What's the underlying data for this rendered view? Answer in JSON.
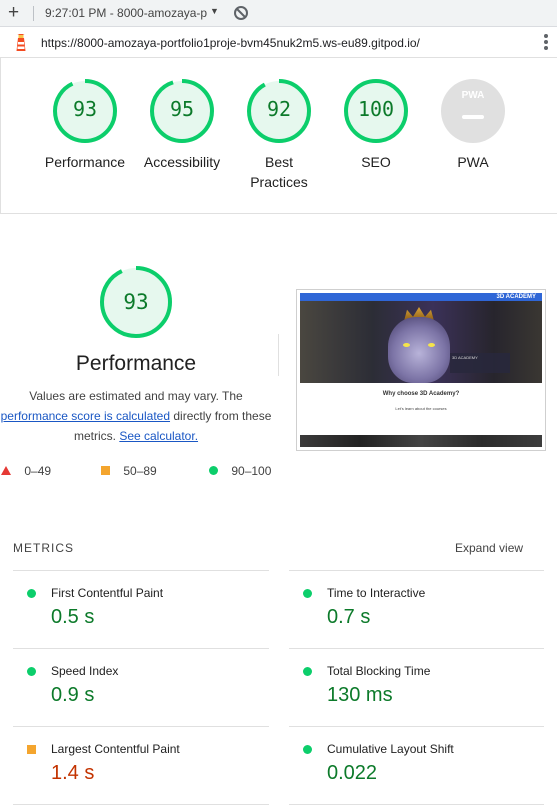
{
  "browser": {
    "tab_title": "9:27:01 PM - 8000-amozaya-p",
    "url": "https://8000-amozaya-portfolio1proje-bvm45nuk2m5.ws-eu89.gitpod.io/"
  },
  "gauges": [
    {
      "score": "93",
      "label": "Performance",
      "status": "pass"
    },
    {
      "score": "95",
      "label": "Accessibility",
      "status": "pass"
    },
    {
      "score": "92",
      "label": "Best Practices",
      "status": "pass"
    },
    {
      "score": "100",
      "label": "SEO",
      "status": "pass"
    },
    {
      "score": "",
      "label": "PWA",
      "status": "na",
      "badge": "PWA"
    }
  ],
  "performance": {
    "score": "93",
    "title": "Performance",
    "desc_part1": "Values are estimated and may vary. The",
    "desc_link": "performance score is calculated",
    "desc_part2": "directly from these",
    "desc_part3": "metrics.",
    "calc_link": "See calculator."
  },
  "legend": {
    "fail": "0–49",
    "average": "50–89",
    "pass": "90–100"
  },
  "thumbnail": {
    "brand": "3D ACADEMY",
    "hero_caption": "3D ACADEMY",
    "heading": "Why choose 3D Academy?",
    "subtext": "Let's learn about the courses"
  },
  "metrics": {
    "heading": "METRICS",
    "expand": "Expand view",
    "items": [
      {
        "name": "First Contentful Paint",
        "value": "0.5 s",
        "status": "pass"
      },
      {
        "name": "Time to Interactive",
        "value": "0.7 s",
        "status": "pass"
      },
      {
        "name": "Speed Index",
        "value": "0.9 s",
        "status": "pass"
      },
      {
        "name": "Total Blocking Time",
        "value": "130 ms",
        "status": "pass"
      },
      {
        "name": "Largest Contentful Paint",
        "value": "1.4 s",
        "status": "average"
      },
      {
        "name": "Cumulative Layout Shift",
        "value": "0.022",
        "status": "pass"
      }
    ]
  },
  "colors": {
    "pass": "#0cce6b",
    "pass_text": "#0c7a2a",
    "average": "#f4a52e",
    "average_text": "#c33300",
    "fail": "#e53935",
    "gauge_bg": "#e6f8ee"
  }
}
